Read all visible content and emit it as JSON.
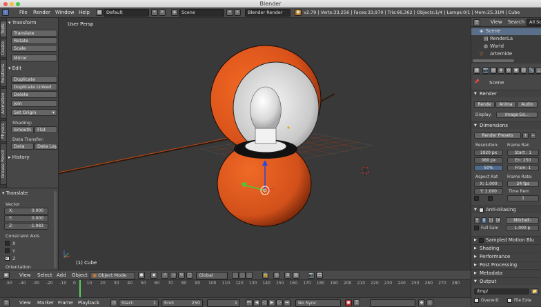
{
  "window": {
    "title": "Blender"
  },
  "info_bar": {
    "menus": [
      "File",
      "Render",
      "Window",
      "Help"
    ],
    "layout": "Default",
    "scene": "Scene",
    "engine": "Blender Render",
    "stats": "v2.79 | Verts:33,256 | Faces:33,970 | Tris:66,362 | Objects:1/4 | Lamps:0/1 | Mem:25.31M | Cube"
  },
  "tool_tabs": [
    "Tools",
    "Create",
    "Relations",
    "Animation",
    "Physics",
    "Grease Pencil"
  ],
  "tool_shelf": {
    "transform_header": "Transform",
    "transform_buttons": [
      "Translate",
      "Rotate",
      "Scale"
    ],
    "mirror": "Mirror",
    "edit_header": "Edit",
    "edit_buttons": [
      "Duplicate",
      "Duplicate Linked",
      "Delete"
    ],
    "join": "Join",
    "set_origin": "Set Origin",
    "shading_label": "Shading:",
    "smooth": "Smooth",
    "flat": "Flat",
    "data_transfer_label": "Data Transfer:",
    "data": "Data",
    "data_lay": "Data Lay",
    "history_header": "History"
  },
  "operator": {
    "header": "Translate",
    "vector_label": "Vector",
    "x_label": "X:",
    "x_value": "0.000",
    "y_label": "Y:",
    "y_value": "0.000",
    "z_label": "Z:",
    "z_value": "-1.983",
    "constraint_label": "Constraint Axis",
    "axis_x": "X",
    "axis_y": "Y",
    "axis_z": "Z",
    "orientation_label": "Orientation"
  },
  "viewport": {
    "view_name": "User Persp",
    "object_label": "(1) Cube"
  },
  "viewport_header": {
    "menus": [
      "View",
      "Select",
      "Add",
      "Object"
    ],
    "mode": "Object Mode",
    "orientation": "Global"
  },
  "timeline": {
    "ticks": [
      "-50",
      "-40",
      "-30",
      "-20",
      "-10",
      "0",
      "10",
      "20",
      "30",
      "40",
      "50",
      "60",
      "70",
      "80",
      "90",
      "100",
      "110",
      "120",
      "130",
      "140",
      "150",
      "160",
      "170",
      "180",
      "190",
      "200",
      "210",
      "220",
      "230",
      "240",
      "250",
      "260",
      "270",
      "280"
    ],
    "menus": [
      "View",
      "Marker",
      "Frame",
      "Playback"
    ],
    "start_label": "Start:",
    "start_value": "1",
    "end_label": "End:",
    "end_value": "250",
    "current": "1",
    "sync": "No Sync"
  },
  "outliner": {
    "menus": [
      "View",
      "Search"
    ],
    "filter": "All Sce",
    "items": [
      "Scene",
      "RenderLa",
      "World",
      "Artemide"
    ]
  },
  "properties": {
    "context": "Scene",
    "render_header": "Render",
    "render_buttons": [
      "Rende",
      "Anima",
      "Audio"
    ],
    "display_label": "Display:",
    "display_value": "Image Ed...",
    "dimensions_header": "Dimensions",
    "presets": "Render Presets",
    "resolution_label": "Resolution:",
    "res_x": "1920 px",
    "res_y": "080 px",
    "res_pct": "50%",
    "frame_range_label": "Frame Ran",
    "start": "Start : 1",
    "end": "En: 250",
    "frame": "Fram: 1",
    "aspect_label": "Aspect Rat",
    "aspect_x": "X: 1.000",
    "aspect_y": "Y: 1.000",
    "frame_rate_label": "Frame Rate:",
    "fps": "24 fps",
    "time_remap_label": "Time Rem",
    "time_remap_value": "1",
    "aa_header": "Anti-Aliasing",
    "aa_samples": [
      "5",
      "8",
      "11",
      "16"
    ],
    "aa_filter": "Mitchell-",
    "full_sample": "Full Sam",
    "filter_size": "1.000 p",
    "sampled_mb": "Sampled Motion Blu",
    "panels": [
      "Shading",
      "Performance",
      "Post Processing",
      "Metadata",
      "Output"
    ],
    "output_path": "/tmp/",
    "overwrite": "Overwrit",
    "file_ext": "File Exte"
  },
  "colors": {
    "orange": "#e0561a",
    "grid": "#4a4a4a",
    "header": "#4a4a4a"
  }
}
